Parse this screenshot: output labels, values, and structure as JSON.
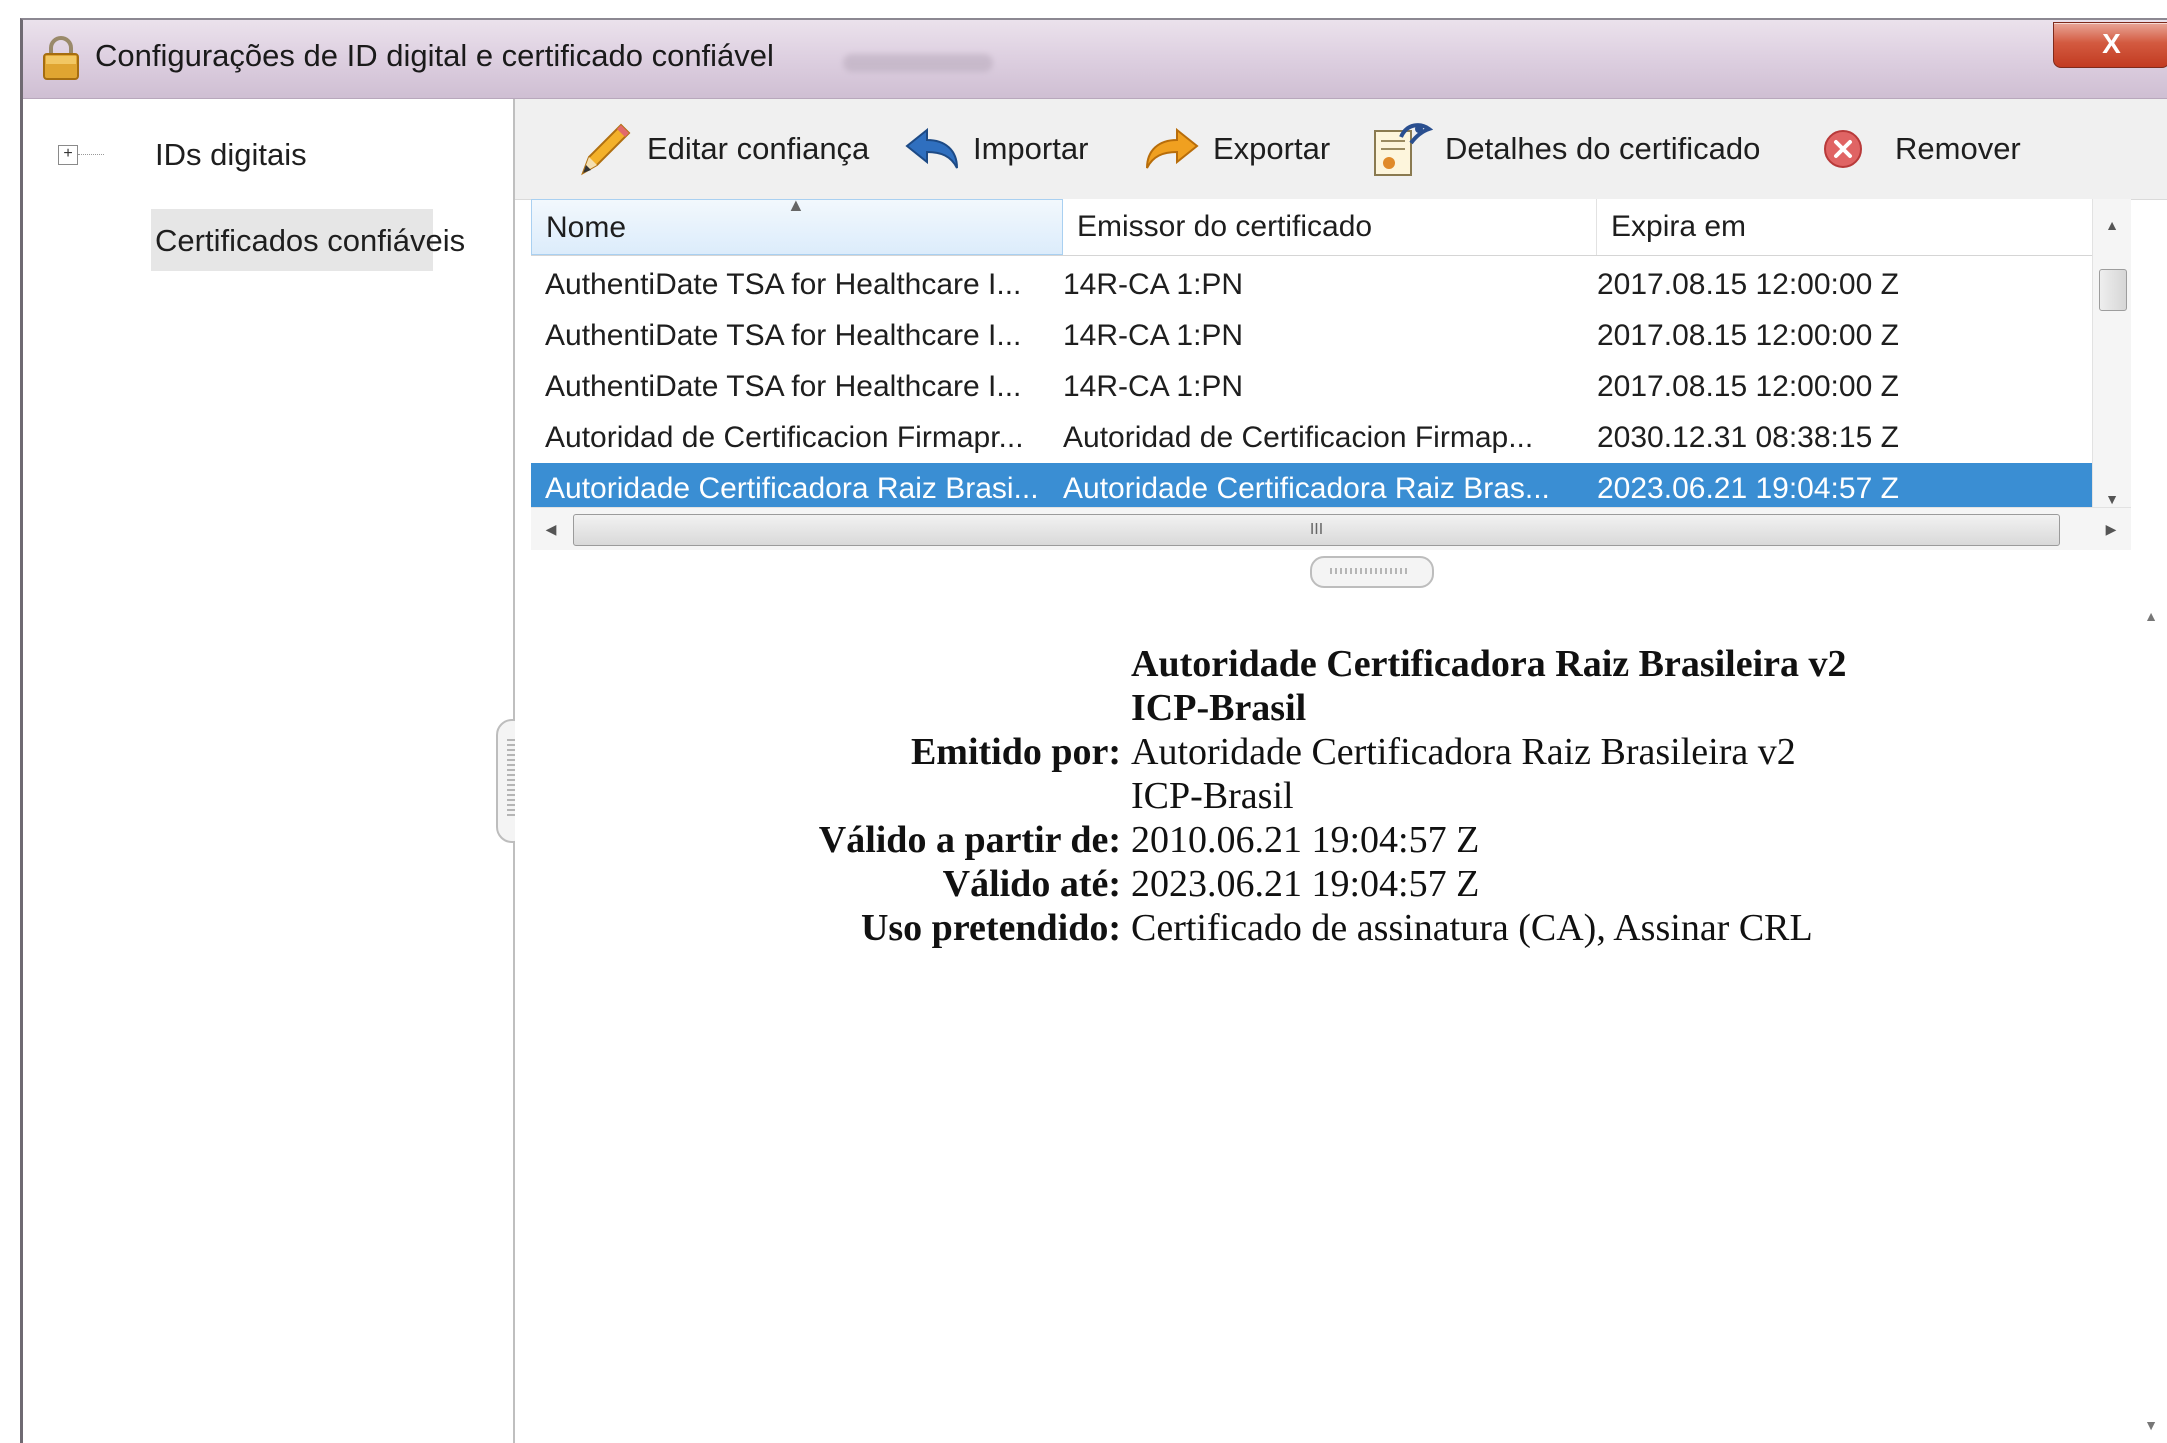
{
  "window": {
    "title": "Configurações de ID digital e certificado confiável",
    "close_label": "X"
  },
  "sidebar": {
    "expander": "+",
    "items": [
      {
        "label": "IDs digitais"
      },
      {
        "label": "Certificados confiáveis"
      }
    ]
  },
  "toolbar": {
    "edit_trust": "Editar confiança",
    "import": "Importar",
    "export": "Exportar",
    "cert_details": "Detalhes do certificado",
    "remove": "Remover"
  },
  "table": {
    "columns": [
      "Nome",
      "Emissor do certificado",
      "Expira em"
    ],
    "rows": [
      {
        "name": "AuthentiDate TSA for Healthcare I...",
        "issuer": "14R-CA 1:PN",
        "expires": "2017.08.15 12:00:00 Z"
      },
      {
        "name": "AuthentiDate TSA for Healthcare I...",
        "issuer": "14R-CA 1:PN",
        "expires": "2017.08.15 12:00:00 Z"
      },
      {
        "name": "AuthentiDate TSA for Healthcare I...",
        "issuer": "14R-CA 1:PN",
        "expires": "2017.08.15 12:00:00 Z"
      },
      {
        "name": "Autoridad de Certificacion Firmapr...",
        "issuer": "Autoridad de Certificacion Firmap...",
        "expires": "2030.12.31 08:38:15 Z"
      },
      {
        "name": "Autoridade Certificadora Raiz Brasi...",
        "issuer": "Autoridade Certificadora Raiz Bras...",
        "expires": "2023.06.21 19:04:57 Z",
        "selected": true
      }
    ],
    "hscroll_grip": "III"
  },
  "details": {
    "subject_line1": "Autoridade Certificadora Raiz Brasileira v2",
    "subject_line2": "ICP-Brasil",
    "issued_by_label": "Emitido por:",
    "issued_by_line1": "Autoridade Certificadora Raiz Brasileira v2",
    "issued_by_line2": "ICP-Brasil",
    "valid_from_label": "Válido a partir de:",
    "valid_from": "2010.06.21 19:04:57 Z",
    "valid_to_label": "Válido até:",
    "valid_to": "2023.06.21 19:04:57 Z",
    "usage_label": "Uso pretendido:",
    "usage": "Certificado de assinatura (CA), Assinar CRL"
  },
  "colors": {
    "selection": "#3a8ed3",
    "close_button": "#c8452b"
  }
}
